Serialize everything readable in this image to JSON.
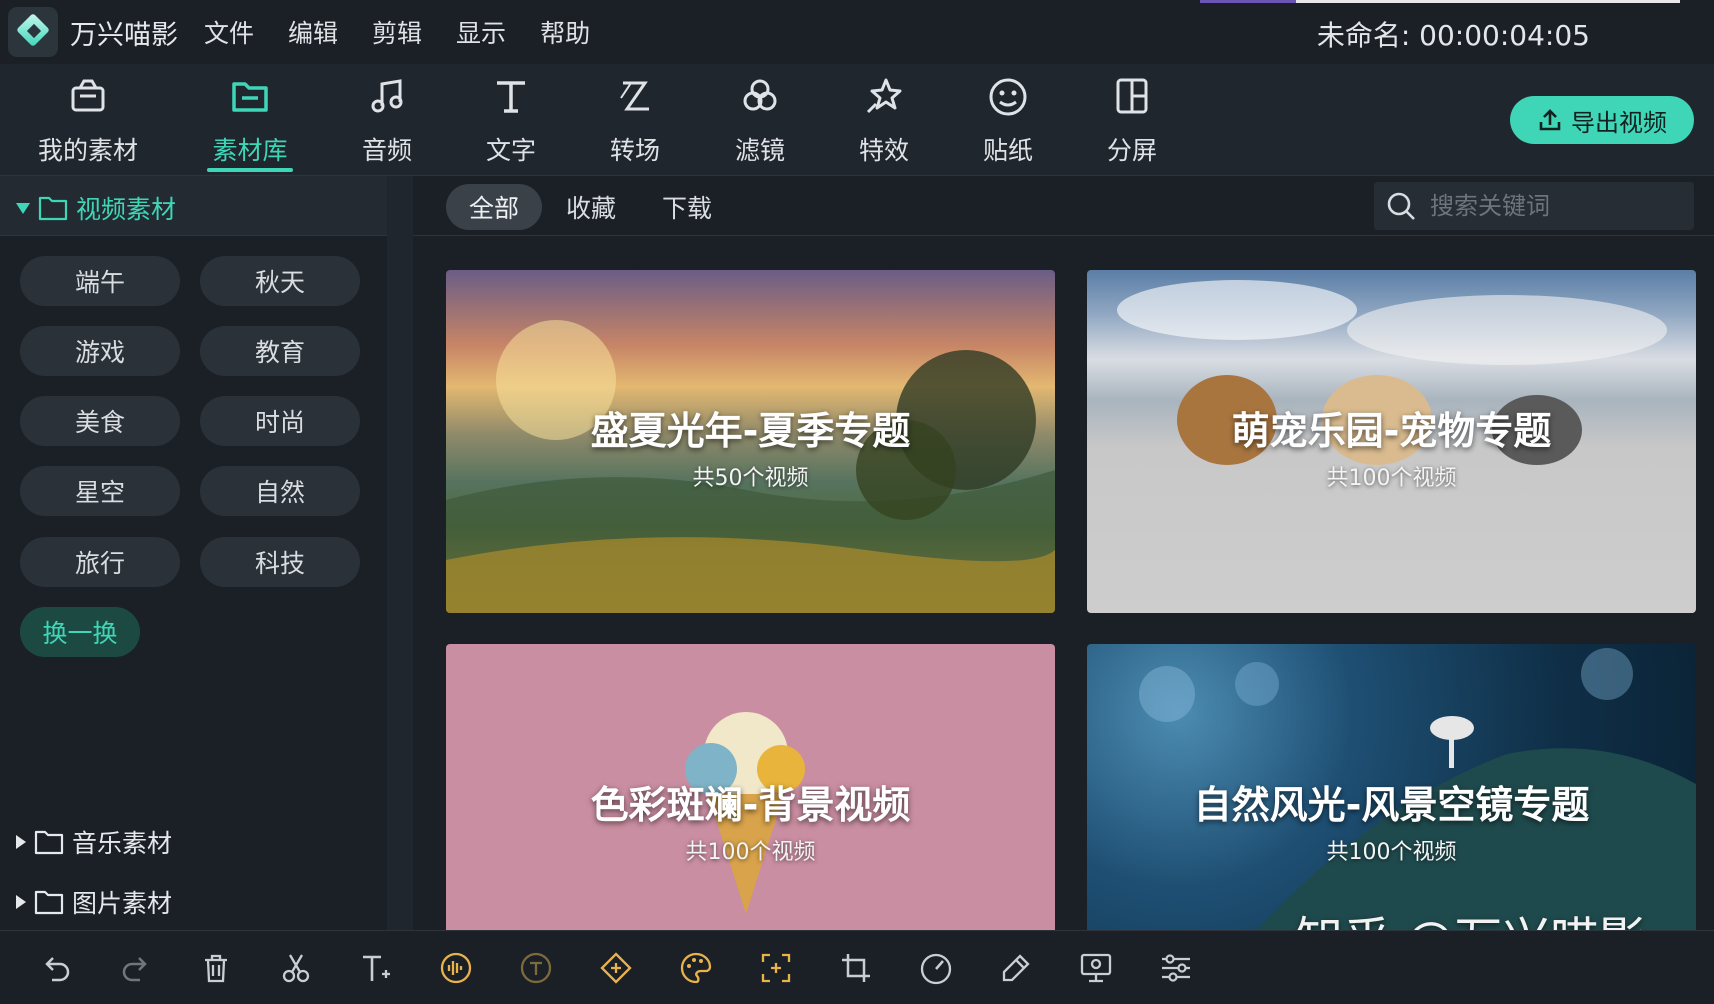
{
  "menubar": {
    "app_name": "万兴喵影",
    "menu_items": [
      "文件",
      "编辑",
      "剪辑",
      "显示",
      "帮助"
    ],
    "project_title": "未命名: 00:00:04:05"
  },
  "toolbar": {
    "tools": [
      {
        "label": "我的素材",
        "icon": "my-media-icon"
      },
      {
        "label": "素材库",
        "icon": "folder-icon",
        "active": true
      },
      {
        "label": "音频",
        "icon": "music-note-icon"
      },
      {
        "label": "文字",
        "icon": "text-icon"
      },
      {
        "label": "转场",
        "icon": "transition-icon"
      },
      {
        "label": "滤镜",
        "icon": "filter-icon"
      },
      {
        "label": "特效",
        "icon": "effects-star-icon"
      },
      {
        "label": "贴纸",
        "icon": "sticker-smiley-icon"
      },
      {
        "label": "分屏",
        "icon": "split-screen-icon"
      }
    ],
    "export_label": "导出视频"
  },
  "sidebar": {
    "video_folder": "视频素材",
    "tags": [
      "端午",
      "秋天",
      "游戏",
      "教育",
      "美食",
      "时尚",
      "星空",
      "自然",
      "旅行",
      "科技"
    ],
    "refresh_label": "换一换",
    "music_folder": "音乐素材",
    "image_folder": "图片素材"
  },
  "filter": {
    "tabs": [
      "全部",
      "收藏",
      "下载"
    ],
    "active_tab": "全部",
    "search_placeholder": "搜索关键词"
  },
  "cards": [
    {
      "title": "盛夏光年-夏季专题",
      "count": "共50个视频"
    },
    {
      "title": "萌宠乐园-宠物专题",
      "count": "共100个视频"
    },
    {
      "title": "色彩斑斓-背景视频",
      "count": "共100个视频"
    },
    {
      "title": "自然风光-风景空镜专题",
      "count": "共100个视频"
    }
  ],
  "watermark": "知乎 @万兴喵影",
  "bottom_tools": [
    "undo-icon",
    "redo-icon",
    "delete-icon",
    "cut-icon",
    "text-add-icon",
    "audio-wave-icon",
    "speech-icon",
    "keyframe-icon",
    "color-palette-icon",
    "stabilize-icon",
    "crop-icon",
    "speed-icon",
    "eyedropper-icon",
    "screen-record-icon",
    "adjust-icon"
  ],
  "colors": {
    "accent": "#3fd6b8",
    "background": "#1b2027",
    "panel": "#20262e"
  }
}
